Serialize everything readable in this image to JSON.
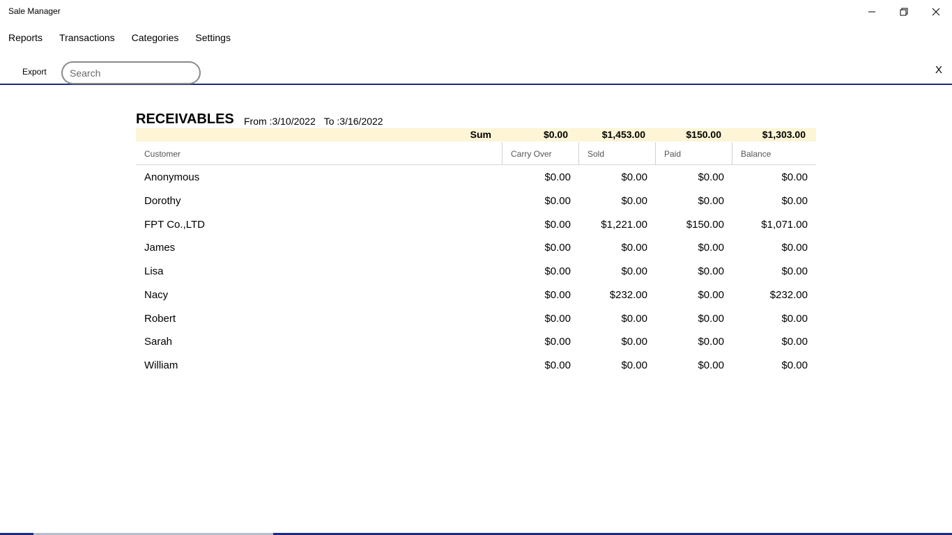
{
  "window": {
    "title": "Sale Manager"
  },
  "menu": {
    "items": [
      "Reports",
      "Transactions",
      "Categories",
      "Settings"
    ]
  },
  "toolbar": {
    "export_label": "Export",
    "search_placeholder": "Search",
    "search_value": "",
    "close_label": "X"
  },
  "report": {
    "title": "RECEIVABLES",
    "from_label": "From :3/10/2022",
    "to_label": "To :3/16/2022"
  },
  "sum": {
    "label": "Sum",
    "carry_over": "$0.00",
    "sold": "$1,453.00",
    "paid": "$150.00",
    "balance": "$1,303.00"
  },
  "columns": {
    "customer": "Customer",
    "carry_over": "Carry Over",
    "sold": "Sold",
    "paid": "Paid",
    "balance": "Balance"
  },
  "rows": [
    {
      "customer": "Anonymous",
      "carry_over": "$0.00",
      "sold": "$0.00",
      "paid": "$0.00",
      "balance": "$0.00"
    },
    {
      "customer": "Dorothy",
      "carry_over": "$0.00",
      "sold": "$0.00",
      "paid": "$0.00",
      "balance": "$0.00"
    },
    {
      "customer": "FPT Co.,LTD",
      "carry_over": "$0.00",
      "sold": "$1,221.00",
      "paid": "$150.00",
      "balance": "$1,071.00"
    },
    {
      "customer": "James",
      "carry_over": "$0.00",
      "sold": "$0.00",
      "paid": "$0.00",
      "balance": "$0.00"
    },
    {
      "customer": "Lisa",
      "carry_over": "$0.00",
      "sold": "$0.00",
      "paid": "$0.00",
      "balance": "$0.00"
    },
    {
      "customer": "Nacy",
      "carry_over": "$0.00",
      "sold": "$232.00",
      "paid": "$0.00",
      "balance": "$232.00"
    },
    {
      "customer": "Robert",
      "carry_over": "$0.00",
      "sold": "$0.00",
      "paid": "$0.00",
      "balance": "$0.00"
    },
    {
      "customer": "Sarah",
      "carry_over": "$0.00",
      "sold": "$0.00",
      "paid": "$0.00",
      "balance": "$0.00"
    },
    {
      "customer": "William",
      "carry_over": "$0.00",
      "sold": "$0.00",
      "paid": "$0.00",
      "balance": "$0.00"
    }
  ],
  "icons": {
    "minimize": "minimize-icon",
    "maximize": "restore-icon",
    "close": "close-icon"
  }
}
